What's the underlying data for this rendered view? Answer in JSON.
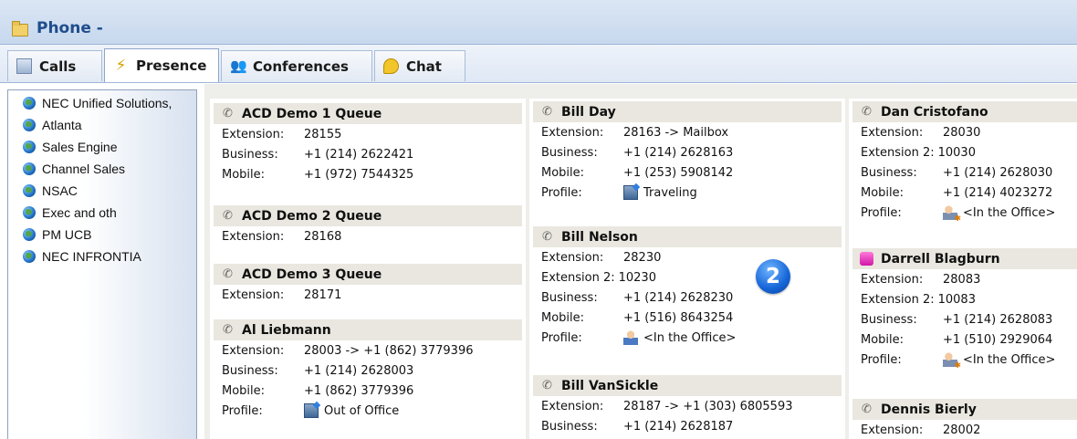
{
  "window": {
    "title": "Phone -"
  },
  "tabs": [
    {
      "label": "Calls",
      "icon": "phone-calls-icon"
    },
    {
      "label": "Presence",
      "icon": "lightning-icon",
      "active": true
    },
    {
      "label": "Conferences",
      "icon": "people-icon"
    },
    {
      "label": "Chat",
      "icon": "chat-bubble-icon"
    }
  ],
  "tree": [
    "NEC Unified Solutions,",
    "Atlanta",
    "Sales Engine",
    "Channel Sales",
    "NSAC",
    "Exec and oth",
    "PM UCB",
    "NEC INFRONTIA"
  ],
  "labels": {
    "extension": "Extension:",
    "extension2": "Extension 2:",
    "business": "Business:",
    "mobile": "Mobile:",
    "profile": "Profile:"
  },
  "columns": [
    {
      "contacts": [
        {
          "name": "ACD Demo 1 Queue",
          "extension": "28155",
          "business": "+1 (214) 2622421",
          "mobile": "+1 (972) 7544325"
        },
        {
          "name": "ACD Demo 2 Queue",
          "extension": "28168"
        },
        {
          "name": "ACD Demo 3 Queue",
          "extension": "28171"
        },
        {
          "name": "Al Liebmann",
          "extension": "28003 -> +1 (862) 3779396",
          "business": "+1 (214) 2628003",
          "mobile": "+1 (862) 3779396",
          "profile": "Out of Office"
        }
      ]
    },
    {
      "contacts": [
        {
          "name": "Bill Day",
          "extension": "28163 -> Mailbox",
          "business": "+1 (214) 2628163",
          "mobile": "+1 (253) 5908142",
          "profile": "Traveling"
        },
        {
          "name": "Bill Nelson",
          "extension": "28230",
          "extension2": "10230",
          "business": "+1 (214) 2628230",
          "mobile": "+1 (516) 8643254",
          "profile": "<In the Office>"
        },
        {
          "name": "Bill VanSickle",
          "extension": "28187 -> +1 (303) 6805593",
          "business": "+1 (214) 2628187"
        }
      ]
    },
    {
      "contacts": [
        {
          "name": "Dan Cristofano",
          "extension": "28030",
          "extension2": "10030",
          "business": "+1 (214) 2628030",
          "mobile": "+1 (214) 4023272",
          "profile": "<In the Office>"
        },
        {
          "name": "Darrell Blagburn",
          "extension": "28083",
          "extension2": "10083",
          "business": "+1 (214) 2628083",
          "mobile": "+1 (510) 2929064",
          "profile": "<In the Office>"
        },
        {
          "name": "Dennis Bierly",
          "extension": "28002"
        }
      ]
    }
  ],
  "badge": {
    "value": "2"
  }
}
